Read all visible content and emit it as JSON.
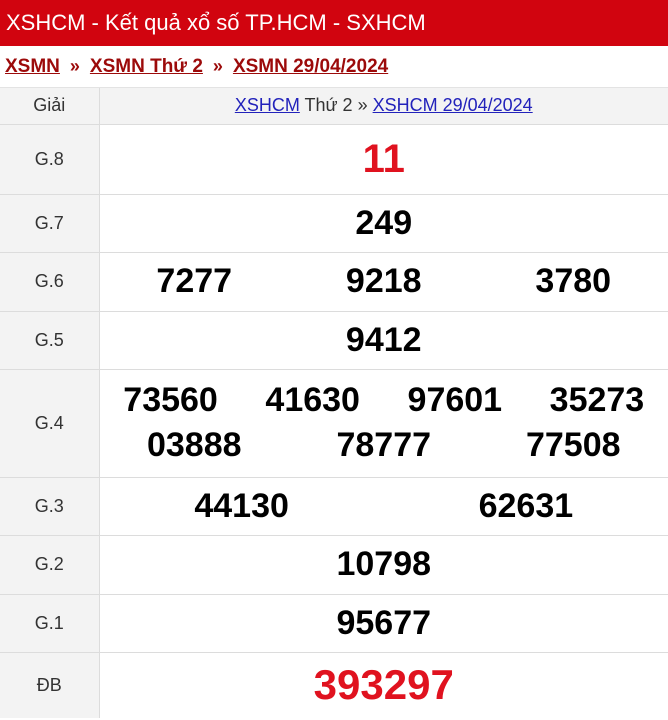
{
  "header": {
    "title": "XSHCM - Kết quả xổ số TP.HCM - SXHCM"
  },
  "breadcrumb": {
    "items": [
      "XSMN",
      "XSMN Thứ 2",
      "XSMN 29/04/2024"
    ],
    "separator": "»"
  },
  "table": {
    "col_label": "Giải",
    "heading": {
      "link1": "XSHCM",
      "text1": " Thứ 2 » ",
      "link2": "XSHCM 29/04/2024"
    },
    "rows": [
      {
        "label": "G.8",
        "numbers": [
          "11"
        ]
      },
      {
        "label": "G.7",
        "numbers": [
          "249"
        ]
      },
      {
        "label": "G.6",
        "numbers": [
          "7277",
          "9218",
          "3780"
        ]
      },
      {
        "label": "G.5",
        "numbers": [
          "9412"
        ]
      },
      {
        "label": "G.4",
        "numbers": [
          "73560",
          "41630",
          "97601",
          "35273",
          "03888",
          "78777",
          "77508"
        ]
      },
      {
        "label": "G.3",
        "numbers": [
          "44130",
          "62631"
        ]
      },
      {
        "label": "G.2",
        "numbers": [
          "10798"
        ]
      },
      {
        "label": "G.1",
        "numbers": [
          "95677"
        ]
      },
      {
        "label": "ĐB",
        "numbers": [
          "393297"
        ]
      }
    ]
  },
  "colors": {
    "header_bg": "#d1040f",
    "prize_red": "#e0121f",
    "breadcrumb_link": "#9c0a0a",
    "heading_link": "#2222bb"
  }
}
